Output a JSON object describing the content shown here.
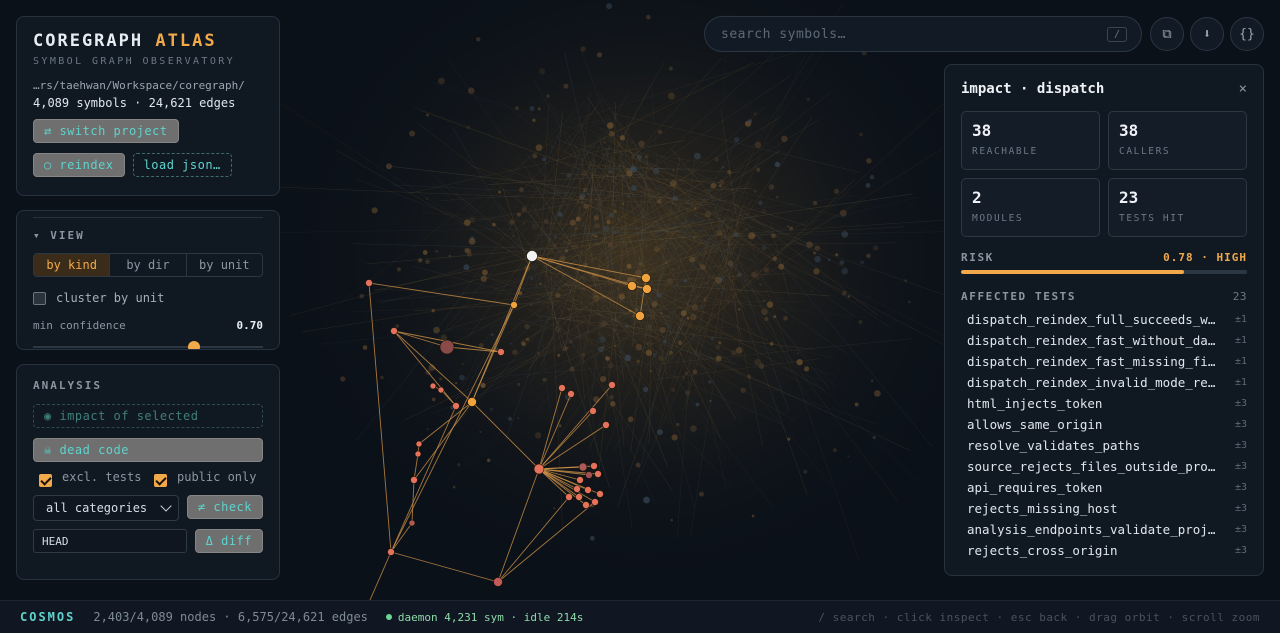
{
  "brand": {
    "name": "COREGRAPH",
    "accent": "ATLAS",
    "subtitle": "SYMBOL GRAPH OBSERVATORY",
    "path": "…rs/taehwan/Workspace/coregraph/",
    "counts": "4,089 symbols · 24,621 edges",
    "switch_label": "⇄ switch project",
    "reindex_label": "○ reindex",
    "load_label": "load json…"
  },
  "view": {
    "title": "▾ VIEW",
    "modes": [
      "by kind",
      "by dir",
      "by unit"
    ],
    "active_mode": 0,
    "cluster_label": "cluster by unit",
    "cluster_checked": false,
    "confidence_label": "min confidence",
    "confidence_value": "0.70",
    "confidence": 0.7
  },
  "analysis": {
    "title": "ANALYSIS",
    "impact_label": "◉ impact of selected",
    "dead_code_label": "☠ dead code",
    "excl_tests_label": "excl. tests",
    "excl_tests_checked": true,
    "public_only_label": "public only",
    "public_only_checked": true,
    "category_value": "all categories",
    "check_label": "≠ check",
    "ref_value": "HEAD",
    "diff_label": "Δ diff"
  },
  "search": {
    "placeholder": "search symbols…",
    "shortcut": "/"
  },
  "toolbar": {
    "copy_icon": "⧉",
    "download_icon": "⬇",
    "json_icon": "{}"
  },
  "impact": {
    "title": "impact · dispatch",
    "close": "×",
    "stats": [
      {
        "value": "38",
        "label": "REACHABLE"
      },
      {
        "value": "38",
        "label": "CALLERS"
      },
      {
        "value": "2",
        "label": "MODULES"
      },
      {
        "value": "23",
        "label": "TESTS HIT"
      }
    ],
    "risk_label": "RISK",
    "risk_value": "0.78 · HIGH",
    "risk": 0.78,
    "tests_label": "AFFECTED TESTS",
    "tests_count": "23",
    "tests": [
      {
        "name": "dispatch_reindex_full_succeeds_when_ready",
        "depth": "±1"
      },
      {
        "name": "dispatch_reindex_fast_without_daemon_fails",
        "depth": "±1"
      },
      {
        "name": "dispatch_reindex_fast_missing_file_errors",
        "depth": "±1"
      },
      {
        "name": "dispatch_reindex_invalid_mode_rejected",
        "depth": "±1"
      },
      {
        "name": "html_injects_token",
        "depth": "±3"
      },
      {
        "name": "allows_same_origin",
        "depth": "±3"
      },
      {
        "name": "resolve_validates_paths",
        "depth": "±3"
      },
      {
        "name": "source_rejects_files_outside_project",
        "depth": "±3"
      },
      {
        "name": "api_requires_token",
        "depth": "±3"
      },
      {
        "name": "rejects_missing_host",
        "depth": "±3"
      },
      {
        "name": "analysis_endpoints_validate_project",
        "depth": "±3"
      },
      {
        "name": "rejects_cross_origin",
        "depth": "±3"
      }
    ]
  },
  "status": {
    "brand": "COSMOS",
    "counts": "2,403/4,089 nodes · 6,575/24,621 edges",
    "daemon": "daemon 4,231 sym · idle 214s",
    "hints": "/ search · click inspect · esc back · drag orbit · scroll zoom"
  },
  "colors": {
    "accent": "#f2a94a",
    "teal": "#5ed3cc",
    "node_red": "#e5735c",
    "node_orange": "#f0a33d",
    "background": "#0b1119"
  }
}
